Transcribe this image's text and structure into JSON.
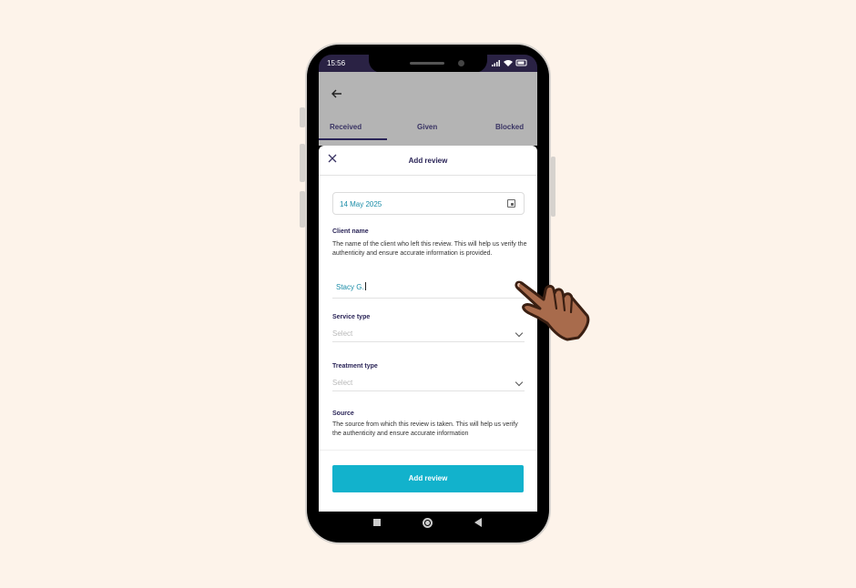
{
  "status_bar": {
    "time": "15:56"
  },
  "tabs": [
    {
      "label": "Received",
      "active": true
    },
    {
      "label": "Given",
      "active": false
    },
    {
      "label": "Blocked",
      "active": false
    }
  ],
  "sheet": {
    "title": "Add review",
    "date_value": "14 May 2025",
    "client_name": {
      "label": "Client name",
      "help": "The name of the client who left this review. This will help us verify the authenticity and ensure accurate information is provided.",
      "value": "Stacy G."
    },
    "service_type": {
      "label": "Service type",
      "placeholder": "Select"
    },
    "treatment_type": {
      "label": "Treatment type",
      "placeholder": "Select"
    },
    "source": {
      "label": "Source",
      "help": "The source from which this review is taken. This will help us verify the authenticity and ensure accurate information"
    },
    "submit_label": "Add review"
  },
  "colors": {
    "accent": "#12b2cc",
    "navy": "#2a2457",
    "page_bg": "#fdf3ea"
  }
}
